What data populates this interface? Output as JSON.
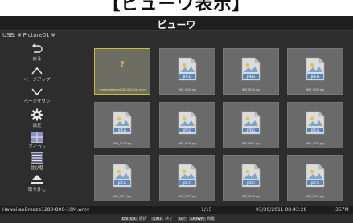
{
  "caption": "【ビューワ表示】",
  "window": {
    "title": "ビューワ"
  },
  "path": "USB: ¥ Picture01 ¥",
  "sidebar": {
    "items": [
      {
        "label": "戻る",
        "icon": "back-arrow-icon"
      },
      {
        "label": "ページアップ",
        "icon": "chevron-up-icon"
      },
      {
        "label": "ページダウン",
        "icon": "chevron-down-icon"
      },
      {
        "label": "設定",
        "icon": "gear-icon"
      },
      {
        "label": "アイコン",
        "icon": "grid-icon"
      },
      {
        "label": "並び替",
        "icon": "list-icon"
      },
      {
        "label": "取り外し",
        "icon": "eject-icon"
      }
    ]
  },
  "grid": {
    "files": [
      {
        "name": "HawaiianBreeze1280-800-10M.wmv",
        "type": "unknown",
        "selected": true
      },
      {
        "name": "IMG_0101.jpg",
        "type": "JPEG"
      },
      {
        "name": "IMG_0174.jpg",
        "type": "JPEG"
      },
      {
        "name": "IMG_0107.jpg",
        "type": "JPEG"
      },
      {
        "name": "IMG_0176.jpg",
        "type": "JPEG"
      },
      {
        "name": "IMG_0108.jpg",
        "type": "JPEG"
      },
      {
        "name": "IMG_0071.jpg",
        "type": "JPEG"
      },
      {
        "name": "IMG_0016.jpg",
        "type": "JPEG"
      },
      {
        "name": "IMG_0011.jpg",
        "type": "JPEG"
      },
      {
        "name": "IMG_0072.jpg",
        "type": "JPEG"
      },
      {
        "name": "IMG_0018.jpg",
        "type": "JPEG"
      },
      {
        "name": "IMG_0019.jpg",
        "type": "JPEG"
      }
    ],
    "thumb_label": "JPEG",
    "unknown_label": "?"
  },
  "status": {
    "filename": "HawaiianBreeze1280-800-10M.wmv",
    "page": "1/15",
    "datetime": "03/30/2011 08:43:28",
    "size": "357M"
  },
  "hints": [
    {
      "key": "ENTER",
      "label": "選択"
    },
    {
      "key": "EXIT",
      "label": "終了"
    },
    {
      "key": "UP",
      "label": ""
    },
    {
      "key": "DOWN",
      "label": "移動"
    }
  ]
}
